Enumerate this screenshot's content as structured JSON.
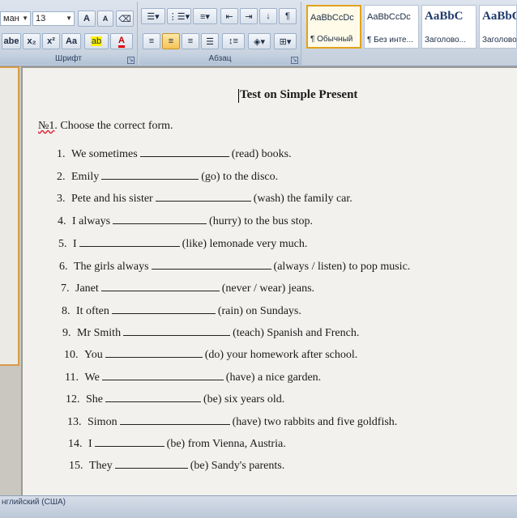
{
  "ribbon": {
    "font_group": {
      "font_name": "ман",
      "font_size": "13",
      "grow_font_label": "A",
      "shrink_font_label": "A",
      "subscript_label": "x₂",
      "superscript_label": "x²",
      "change_case_label": "Aa",
      "highlight_label": "ab",
      "font_color_label": "A",
      "group_label": "Шрифт"
    },
    "paragraph_group": {
      "group_label": "Абзац"
    },
    "styles": [
      {
        "sample": "AaBbCcDc",
        "name": "¶ Обычный",
        "active": true
      },
      {
        "sample": "AaBbCcDc",
        "name": "¶ Без инте...",
        "active": false
      },
      {
        "sample": "AaBbC",
        "name": "Заголово...",
        "active": false
      },
      {
        "sample": "AaBbC",
        "name": "Заголово",
        "active": false
      }
    ],
    "accent_color": "#f6c253"
  },
  "document": {
    "title": "Test on Simple Present",
    "task_number": "№1",
    "task_text": ". Choose the correct form.",
    "items": [
      {
        "n": "1.",
        "before": "We sometimes",
        "after": "(read)  books."
      },
      {
        "n": "2.",
        "before": "Emily",
        "after": "(go)  to the disco."
      },
      {
        "n": "3.",
        "before": "Pete and his sister",
        "after": "(wash)  the family car."
      },
      {
        "n": "4.",
        "before": "I always",
        "after": "(hurry)  to the bus stop."
      },
      {
        "n": "5.",
        "before": "I",
        "after": "(like) lemonade very much."
      },
      {
        "n": "6.",
        "before": "The girls always",
        "after": "(always / listen) to pop music."
      },
      {
        "n": "7.",
        "before": "Janet",
        "after": "(never / wear) jeans."
      },
      {
        "n": "8.",
        "before": "It often",
        "after": "(rain)  on Sundays."
      },
      {
        "n": "9.",
        "before": "Mr Smith",
        "after": "(teach) Spanish and French."
      },
      {
        "n": "10.",
        "before": "You",
        "after": "(do) your homework after school."
      },
      {
        "n": "11.",
        "before": "We",
        "after": "(have)  a nice garden."
      },
      {
        "n": "12.",
        "before": "She",
        "after": "(be)  six years old."
      },
      {
        "n": "13.",
        "before": "Simon",
        "after": "(have) two rabbits and five goldfish."
      },
      {
        "n": "14.",
        "before": "I",
        "after": "(be) from Vienna, Austria."
      },
      {
        "n": "15.",
        "before": "They",
        "after": "(be) Sandy's parents."
      }
    ]
  },
  "statusbar": {
    "language": "нглийский (США)"
  }
}
